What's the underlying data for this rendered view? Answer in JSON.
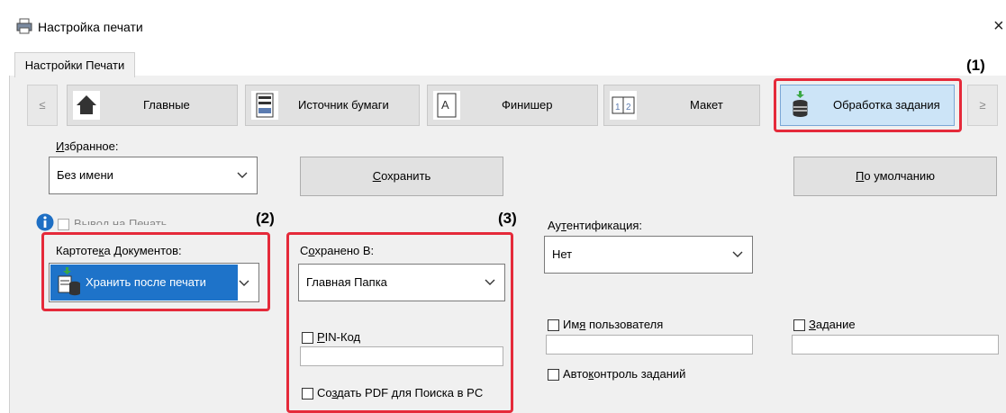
{
  "window": {
    "title": "Настройка печати",
    "close_glyph": "×"
  },
  "tabs": [
    {
      "label": "Настройки Печати"
    }
  ],
  "nav": {
    "prev_label": "≤",
    "next_label": "≥",
    "buttons": [
      {
        "label": "Главные",
        "icon": "home-icon"
      },
      {
        "label": "Источник бумаги",
        "icon": "paper-source-icon"
      },
      {
        "label": "Финишер",
        "icon": "finisher-icon"
      },
      {
        "label": "Макет",
        "icon": "layout-icon"
      },
      {
        "label": "Обработка задания",
        "icon": "job-handling-icon",
        "selected": true
      }
    ]
  },
  "favorites": {
    "label_pre": "",
    "label_u": "И",
    "label_post": "збранное:",
    "value": "Без имени",
    "save_pre": "",
    "save_u": "С",
    "save_post": "охранить",
    "default_pre": "",
    "default_u": "П",
    "default_post": "о умолчанию"
  },
  "info": {
    "partial_checkbox_label": "Вывод на Печать"
  },
  "callouts": {
    "c1": "(1)",
    "c2": "(2)",
    "c3": "(3)"
  },
  "document_filing": {
    "label_pre": "Картоте",
    "label_u": "к",
    "label_post": "а Документов:",
    "value": "Хранить после печати"
  },
  "stored_to": {
    "label_pre": "С",
    "label_u": "о",
    "label_post": "хранено В:",
    "value": "Главная Папка",
    "pin_pre": "",
    "pin_u": "P",
    "pin_post": "IN-Код",
    "pdf_pre": "Со",
    "pdf_u": "з",
    "pdf_post": "дать PDF для Поиска в PC"
  },
  "auth": {
    "label_pre": "Ау",
    "label_u": "т",
    "label_post": "ентификация:",
    "value": "Нет",
    "username_pre": "Им",
    "username_u": "я",
    "username_post": " пользователя",
    "job_pre": "",
    "job_u": "З",
    "job_post": "адание",
    "autojob_pre": "Авто",
    "autojob_u": "к",
    "autojob_post": "онтроль заданий"
  }
}
